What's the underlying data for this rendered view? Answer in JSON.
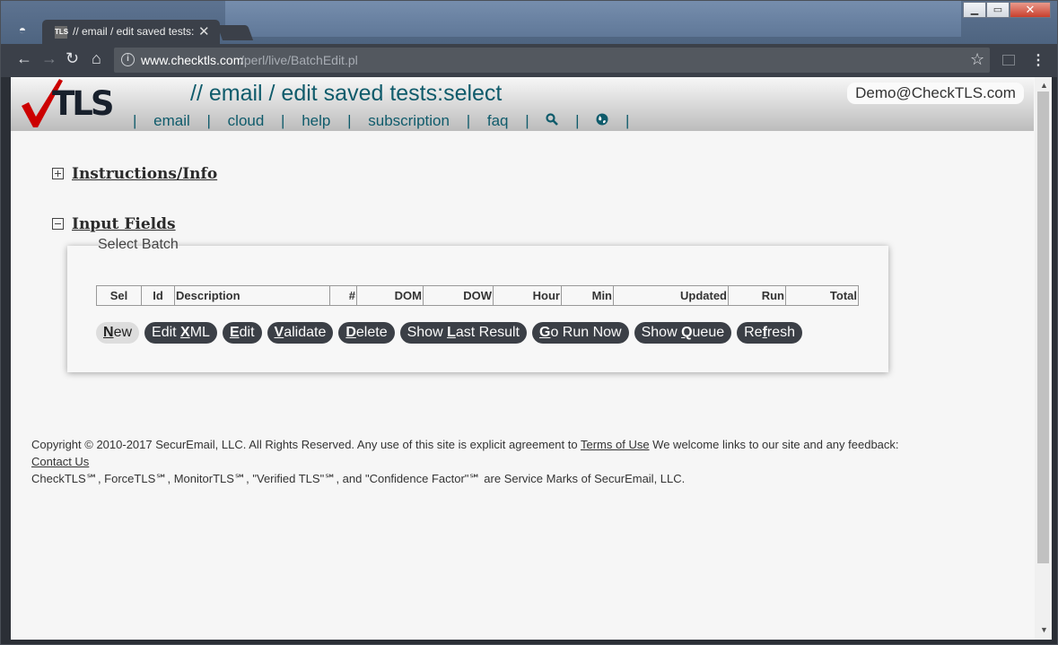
{
  "browser": {
    "tab_title": "// email / edit saved tests:",
    "tab_favicon_text": "TLS",
    "url_host": "www.checktls.com",
    "url_path": "/perl/live/BatchEdit.pl"
  },
  "header": {
    "logo_text": "TLS",
    "title": "// email / edit saved tests:select",
    "user": "Demo@CheckTLS.com",
    "nav": [
      "email",
      "cloud",
      "help",
      "subscription",
      "faq"
    ]
  },
  "sections": {
    "instructions": "Instructions/Info",
    "input_fields": "Input Fields",
    "legend": "Select Batch"
  },
  "table": {
    "columns": [
      "Sel",
      "Id",
      "Description",
      "#",
      "DOM",
      "DOW",
      "Hour",
      "Min",
      "Updated",
      "Run",
      "Total"
    ]
  },
  "buttons": [
    {
      "accel": "N",
      "rest": "ew"
    },
    {
      "pre": "Edit ",
      "accel": "X",
      "rest": "ML"
    },
    {
      "accel": "E",
      "rest": "dit"
    },
    {
      "accel": "V",
      "rest": "alidate"
    },
    {
      "accel": "D",
      "rest": "elete"
    },
    {
      "pre": "Show ",
      "accel": "L",
      "rest": "ast Result"
    },
    {
      "accel": "G",
      "rest": "o Run Now"
    },
    {
      "pre": "Show ",
      "accel": "Q",
      "rest": "ueue"
    },
    {
      "pre": "Re",
      "accel": "f",
      "rest": "resh"
    }
  ],
  "footer": {
    "line1": "Copyright © 2010-2017 SecurEmail, LLC. All Rights Reserved. Any use of this site is explicit agreement to ",
    "terms": "Terms of Use",
    "line1_end": " We welcome links to our site and any feedback:",
    "contact": "Contact Us",
    "line3": "CheckTLS℠, ForceTLS℠, MonitorTLS℠, \"Verified TLS\"℠, and \"Confidence Factor\"℠ are Service Marks of SecurEmail, LLC."
  },
  "colors": {
    "accent": "#0f5b6b",
    "logo_check": "#cc0000",
    "button": "#3b3f46"
  }
}
